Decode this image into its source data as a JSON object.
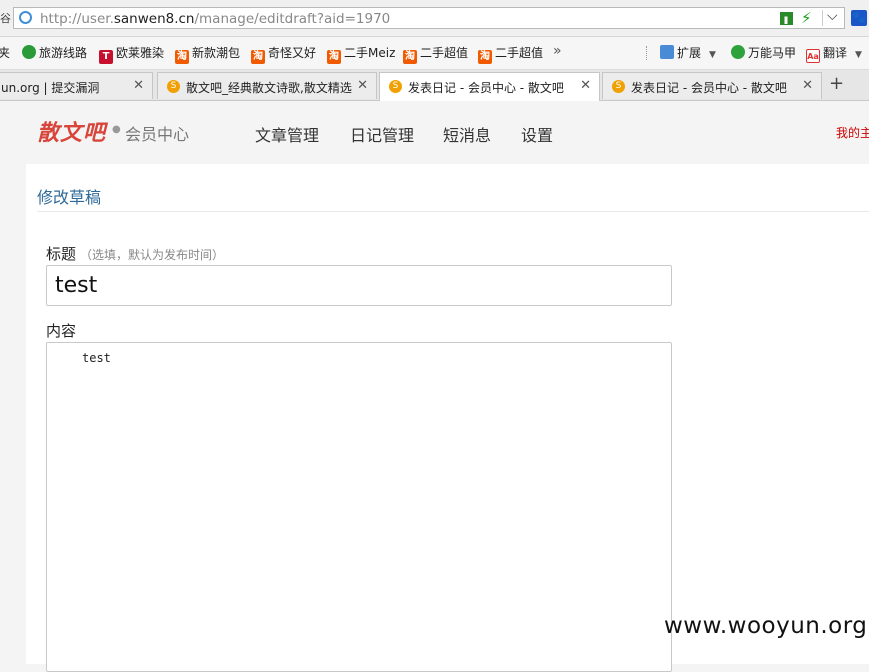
{
  "address_bar": {
    "left_fragment": "谷",
    "url_prefix": "http://user.",
    "url_domain": "sanwen8.cn",
    "url_path": "/manage/editdraft?aid=1970"
  },
  "bookmarks": {
    "items": [
      {
        "label": "夹",
        "icon": "none"
      },
      {
        "label": "旅游线路",
        "icon": "leaf-icon"
      },
      {
        "label": "欧莱雅染",
        "icon": "t-icon"
      },
      {
        "label": "新款潮包",
        "icon": "taobao-icon"
      },
      {
        "label": "奇怪又好",
        "icon": "taobao-icon"
      },
      {
        "label": "二手Meiz",
        "icon": "taobao-icon"
      },
      {
        "label": "二手超值",
        "icon": "taobao-icon"
      },
      {
        "label": "二手超值",
        "icon": "taobao-icon"
      }
    ],
    "more": "»",
    "extensions": "扩展",
    "wanneng": "万能马甲",
    "translate": "翻译"
  },
  "tabs": [
    {
      "label": "un.org | 提交漏洞",
      "active": false
    },
    {
      "label": "散文吧_经典散文诗歌,散文精选",
      "active": false
    },
    {
      "label": "发表日记 - 会员中心 - 散文吧",
      "active": true
    },
    {
      "label": "发表日记 - 会员中心 - 散文吧",
      "active": false
    }
  ],
  "site": {
    "logo": "散文吧",
    "section": "会员中心",
    "nav": [
      "文章管理",
      "日记管理",
      "短消息",
      "设置"
    ],
    "my_link": "我的主"
  },
  "form": {
    "heading": "修改草稿",
    "title_label": "标题",
    "title_hint": "（选填，默认为发布时间）",
    "title_value": "test",
    "content_label": "内容",
    "content_value": "test"
  },
  "watermark": "www.wooyun.org",
  "colors": {
    "logo": "#d8453a",
    "heading": "#2d6a99",
    "my_link": "#cc0000",
    "taobao": "#f05a00"
  }
}
